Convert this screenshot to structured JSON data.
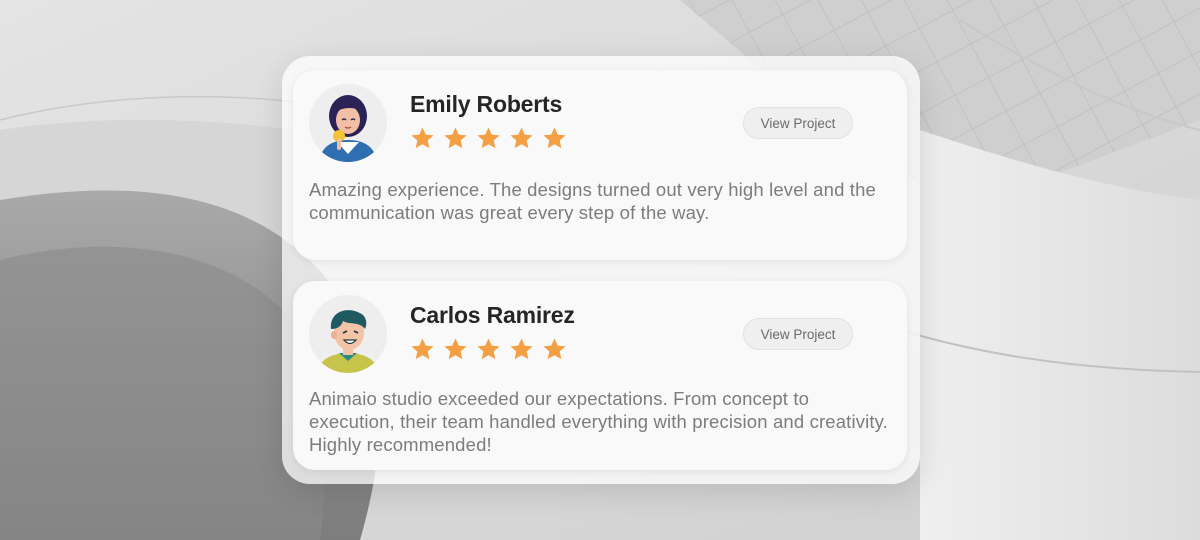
{
  "colors": {
    "star": "#f3a044",
    "name": "#252525",
    "body_text": "#7c7c7c",
    "button_bg": "#efefef",
    "card_bg": "#f9f9f9"
  },
  "reviews": [
    {
      "name": "Emily Roberts",
      "rating": 5,
      "button_label": "View Project",
      "text": "Amazing experience. The designs turned out very high level and the communication was great every step of the way.",
      "avatar_icon": "woman-avatar-icon"
    },
    {
      "name": "Carlos Ramirez",
      "rating": 5,
      "button_label": "View Project",
      "text": "Animaio studio exceeded our expectations. From concept to execution, their team handled everything with precision and creativity. Highly recommended!",
      "avatar_icon": "man-avatar-icon"
    }
  ]
}
